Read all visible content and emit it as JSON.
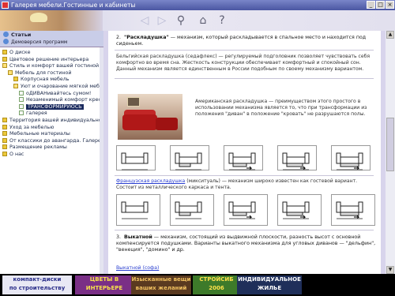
{
  "window": {
    "title": "Галерея мебели.Гостинные и кабинеты"
  },
  "toolbar": {
    "icons": [
      "back-arrow-icon",
      "forward-arrow-icon",
      "search-icon",
      "home-icon",
      "help-icon"
    ]
  },
  "sidebar": {
    "tab_label": "Статьи",
    "sub_label": "Демоверсия программ",
    "tree": [
      {
        "label": "О диске",
        "level": 0,
        "icon": "folder"
      },
      {
        "label": "Цветовое решение интерьера",
        "level": 0,
        "icon": "folder"
      },
      {
        "label": "Стиль и комфорт вашей гостиной",
        "level": 0,
        "icon": "folder-open"
      },
      {
        "label": "Мебель для гостиной",
        "level": 1,
        "icon": "folder-open"
      },
      {
        "label": "Корпусная мебель",
        "level": 2,
        "icon": "folder"
      },
      {
        "label": "Уют и очарование мягкой мебели",
        "level": 2,
        "icon": "folder-open"
      },
      {
        "label": "оДИВАНивайтесь сумом!",
        "level": 3,
        "icon": "doc"
      },
      {
        "label": "Незаменимый комфорт кресла",
        "level": 3,
        "icon": "doc"
      },
      {
        "label": "ТРАНСФОРМИРУЮСЬ",
        "level": 3,
        "icon": "doc",
        "selected": true
      },
      {
        "label": "галерея",
        "level": 3,
        "icon": "doc"
      },
      {
        "label": "Территория вашей индивидуальности",
        "level": 0,
        "icon": "folder"
      },
      {
        "label": "Уход за мебелью",
        "level": 0,
        "icon": "folder"
      },
      {
        "label": "Мебельные материалы",
        "level": 0,
        "icon": "folder"
      },
      {
        "label": "От классики до авангарда. Галерея",
        "level": 0,
        "icon": "folder"
      },
      {
        "label": "Размещение рекламы",
        "level": 0,
        "icon": "folder"
      },
      {
        "label": "О нас",
        "level": 0,
        "icon": "folder"
      }
    ]
  },
  "content": {
    "item2_num": "2.",
    "item2_title": "\"Раскладушка\"",
    "item2_text": " — механизм, который раскладывается в спальное место и находится под сиденьем.",
    "belgian": "Бельгийская раскладушка (седафлекс) — регулируемый подголовник позволяет чувствовать себя комфортно во время сна. Жесткость конструкции обеспечивает комфортный и спокойный сон. Данный механизм является единственным в России подобным по своему механизму вариантом.",
    "american": "Американская раскладушка — преимуществом этого простого в использовании механизма является то, что при трансформации из положения \"диван\" в положение \"кровать\" не разрушаются полы.",
    "french_link": "Французская раскладушка",
    "french_text": " (микситуаль) — механизм широко известен как гостевой вариант. Состоит из металлического каркаса и тента.",
    "item3_num": "3.",
    "item3_title": "Выкатной",
    "item3_text": " — механизм, состоящий из выдвижной плоскости, разность высот с основной компенсируется подушками. Варианты выкатного механизма для угловых диванов — \"дельфин\", \"венеция\", \"домино\" и др.",
    "item3_more": "Выкатной (софа)"
  },
  "footer": {
    "ads": [
      {
        "line1": "компакт-диски",
        "line2": "по строительству",
        "bg": "#e8e8f4",
        "fg": "#2b2f8a"
      },
      {
        "line1": "ЦВЕТЫ В",
        "line2": "ИНТЕРЬЕРЕ",
        "bg": "#7a2f86",
        "fg": "#f7e34a"
      },
      {
        "line1": "Изысканные вещи",
        "line2": "ваших желаний",
        "bg": "#5a3a20",
        "fg": "#f0c060"
      },
      {
        "line1": "СТРОЙСИБ",
        "line2": "2006",
        "bg": "#3d7a2a",
        "fg": "#ffe24a"
      },
      {
        "line1": "ИНДИВИДУАЛЬНОЕ",
        "line2": "ЖИЛЬЕ",
        "bg": "#1f2f5a",
        "fg": "#ffffff"
      }
    ]
  },
  "colors": {
    "accent": "#1a2a5e",
    "link": "#2a3fd0",
    "titlebar": "#4a56a2"
  }
}
